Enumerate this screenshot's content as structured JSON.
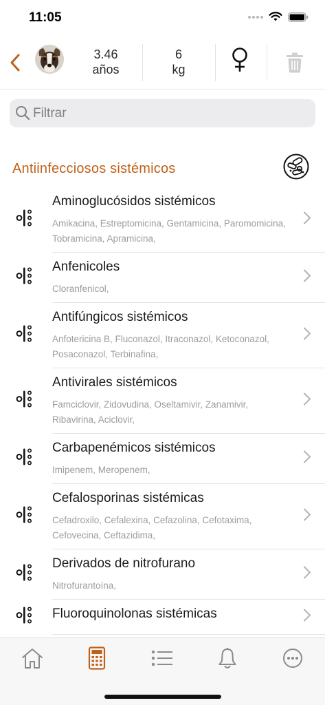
{
  "status_bar": {
    "time": "11:05"
  },
  "header": {
    "age_value": "3.46",
    "age_unit": "años",
    "weight_value": "6",
    "weight_unit": "kg",
    "sex": "female-symbol",
    "accent_color": "#c0611a"
  },
  "search": {
    "placeholder": "Filtrar"
  },
  "section": {
    "title": "Antiinfecciosos sistémicos",
    "icon": "bacteria-icon"
  },
  "items": [
    {
      "title": "Aminoglucósidos sistémicos",
      "subtitle": "Amikacina, Estreptomicina, Gentamicina, Paromomicina, Tobramicina, Apramicina,"
    },
    {
      "title": "Anfenicoles",
      "subtitle": "Cloranfenicol,"
    },
    {
      "title": "Antifúngicos sistémicos",
      "subtitle": "Anfotericina B, Fluconazol, Itraconazol, Ketoconazol, Posaconazol, Terbinafina,"
    },
    {
      "title": "Antivirales sistémicos",
      "subtitle": "Famciclovir, Zidovudina, Oseltamivir, Zanamivir, Ribavirina, Aciclovir,"
    },
    {
      "title": "Carbapenémicos sistémicos",
      "subtitle": "Imipenem, Meropenem,"
    },
    {
      "title": "Cefalosporinas sistémicas",
      "subtitle": "Cefadroxilo, Cefalexina, Cefazolina, Cefotaxima, Cefovecina, Ceftazidima,"
    },
    {
      "title": "Derivados de nitrofurano",
      "subtitle": "Nitrofurantoína,"
    },
    {
      "title": "Fluoroquinolonas sistémicas",
      "subtitle": ""
    }
  ],
  "tabbar": {
    "tabs": [
      "home-icon",
      "calculator-icon",
      "list-icon",
      "bell-icon",
      "more-icon"
    ],
    "active_tab": "calculator-icon"
  }
}
